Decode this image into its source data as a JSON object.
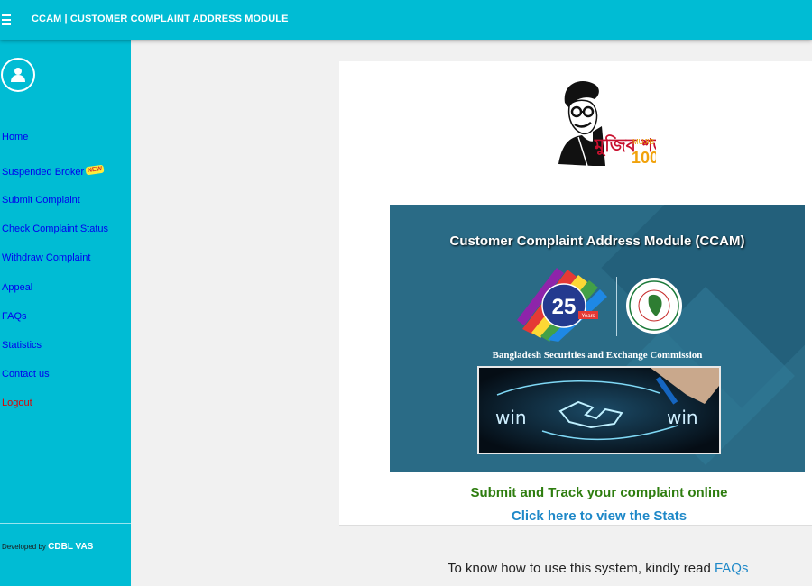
{
  "header": {
    "title": "CCAM | CUSTOMER COMPLAINT ADDRESS MODULE"
  },
  "sidebar": {
    "items": [
      {
        "label": "Home"
      },
      {
        "label": "Suspended Broker",
        "badge": "NEW"
      },
      {
        "label": "Submit Complaint"
      },
      {
        "label": "Check Complaint Status"
      },
      {
        "label": "Withdraw Complaint"
      },
      {
        "label": "Appeal"
      },
      {
        "label": "FAQs"
      },
      {
        "label": "Statistics"
      },
      {
        "label": "Contact us"
      },
      {
        "label": "Logout"
      }
    ],
    "developed_by": "Developed by",
    "developer": "CDBL VAS"
  },
  "main": {
    "mujib_logo_text": "মুজিব শতবর্ষ",
    "mujib_en": "MUJIB",
    "mujib_num": "100",
    "banner": {
      "title": "Customer Complaint Address Module (CCAM)",
      "logo_number": "25",
      "logo_sub": "Years",
      "org": "Bangladesh Securities and Exchange Commission",
      "win_left": "win",
      "win_right": "win"
    },
    "submit_text": "Submit and Track your complaint online",
    "stats_link": "Click here to view the Stats",
    "faq_prefix": "To know how to use this system, kindly read",
    "faq_link": "FAQs"
  },
  "colors": {
    "header_bg": "#00bcd4",
    "sidebar_bg": "#00bcd4",
    "link": "#0000ee",
    "logout": "#e00000",
    "submit_green": "#2e7d0f",
    "stats_blue": "#1e88c8",
    "banner_bg": "#2a6b86"
  }
}
